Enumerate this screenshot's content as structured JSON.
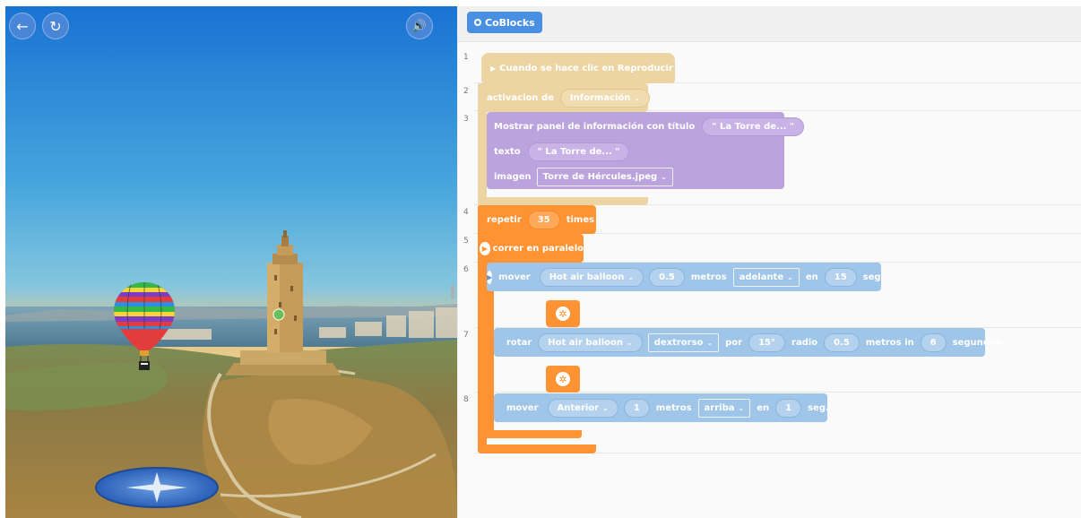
{
  "scene": {
    "balloon_name": "Hot air balloon"
  },
  "toolbar": {
    "coblocks_label": "CoBlocks"
  },
  "lines": [
    "1",
    "2",
    "3",
    "4",
    "5",
    "6",
    "7",
    "8"
  ],
  "blocks": {
    "when_play": "Cuando se hace clic en Reproducir",
    "activation": {
      "label": "activacion de",
      "value": "Información"
    },
    "show_panel": {
      "label": "Mostrar panel de información con título",
      "title_value": "\" La Torre de... \"",
      "text_label": "texto",
      "text_value": "\" La Torre de... \"",
      "image_label": "imagen",
      "image_value": "Torre de Hércules.jpeg"
    },
    "repeat": {
      "label": "repetir",
      "count": "35",
      "suffix": "times"
    },
    "parallel": {
      "label": "correr en paralelo"
    },
    "move1": {
      "label": "mover",
      "object": "Hot air balloon",
      "distance": "0.5",
      "unit": "metros",
      "direction": "adelante",
      "in": "en",
      "time": "15",
      "time_unit": "seg."
    },
    "rotate": {
      "label": "rotar",
      "object": "Hot air balloon",
      "direction": "dextrorso",
      "by": "por",
      "angle": "15°",
      "radius_label": "radio",
      "radius": "0.5",
      "unit_in": "metros in",
      "time": "6",
      "time_unit": "segundos"
    },
    "move2": {
      "label": "mover",
      "object": "Anterior",
      "distance": "1",
      "unit": "metros",
      "direction": "arriba",
      "in": "en",
      "time": "1",
      "time_unit": "seg."
    }
  },
  "colors": {
    "event": "#ecd5a3",
    "looks": "#bba3dd",
    "control": "#ff9333",
    "motion": "#9fc5e8",
    "toolbar_button": "#4a90e2"
  },
  "icons": [
    "back-arrow-icon",
    "restart-icon",
    "volume-icon",
    "play-icon",
    "gear-icon",
    "chevron-down-icon",
    "info-hotspot-icon"
  ]
}
